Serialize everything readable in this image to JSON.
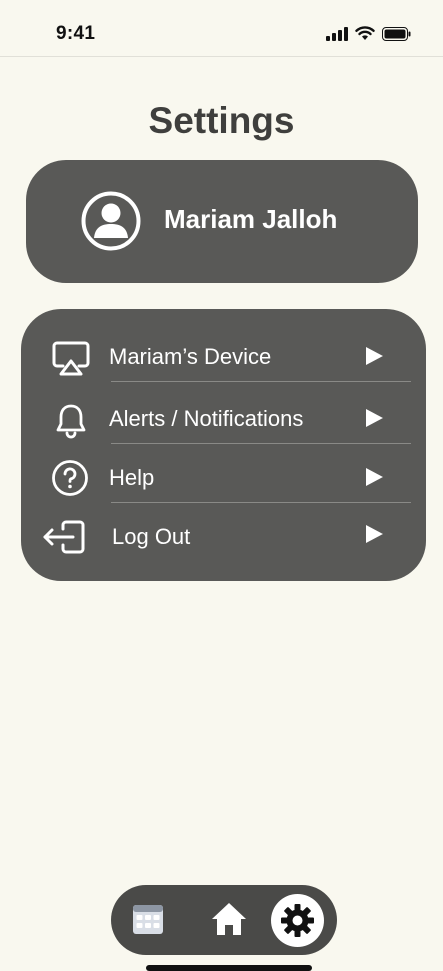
{
  "status_bar": {
    "time": "9:41",
    "icons": [
      "signal-icon",
      "wifi-icon",
      "battery-icon"
    ]
  },
  "page": {
    "title": "Settings"
  },
  "profile": {
    "name": "Mariam Jalloh",
    "icon": "user-avatar-icon"
  },
  "menu": {
    "items": [
      {
        "label": "Mariam’s Device",
        "icon": "screen-cast-icon"
      },
      {
        "label": "Alerts / Notifications",
        "icon": "bell-icon"
      },
      {
        "label": "Help",
        "icon": "help-circle-icon"
      },
      {
        "label": "Log Out",
        "icon": "logout-icon"
      }
    ]
  },
  "bottom_nav": {
    "items": [
      {
        "icon": "calendar-icon",
        "active": false
      },
      {
        "icon": "home-icon",
        "active": false
      },
      {
        "icon": "gear-icon",
        "active": true
      }
    ]
  },
  "colors": {
    "background": "#f9f8ef",
    "card": "#595957",
    "nav": "#4a4a48",
    "title": "#3f3f3d",
    "text_on_card": "#ffffff"
  }
}
